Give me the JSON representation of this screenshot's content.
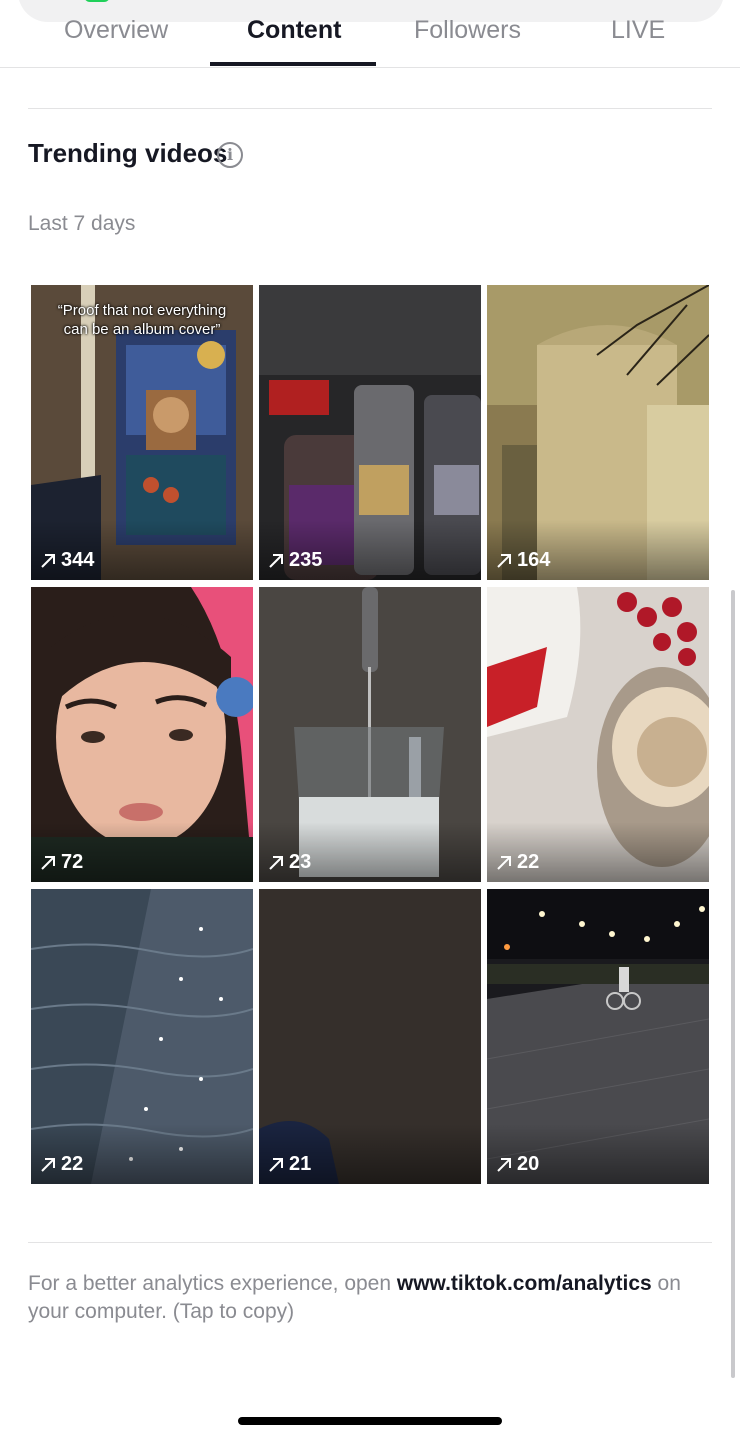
{
  "tabs": [
    {
      "label": "Overview",
      "active": false
    },
    {
      "label": "Content",
      "active": true
    },
    {
      "label": "Followers",
      "active": false
    },
    {
      "label": "LIVE",
      "active": false
    }
  ],
  "trending": {
    "title": "Trending videos",
    "info_icon": "info-icon",
    "period": "Last 7 days",
    "videos": [
      {
        "views": "344",
        "caption": "“Proof that not everything can be an album cover”",
        "icon": "trending-arrow-icon"
      },
      {
        "views": "235",
        "icon": "trending-arrow-icon"
      },
      {
        "views": "164",
        "icon": "trending-arrow-icon"
      },
      {
        "views": "72",
        "icon": "trending-arrow-icon"
      },
      {
        "views": "23",
        "icon": "trending-arrow-icon"
      },
      {
        "views": "22",
        "icon": "trending-arrow-icon"
      },
      {
        "views": "22",
        "icon": "trending-arrow-icon"
      },
      {
        "views": "21",
        "icon": "trending-arrow-icon"
      },
      {
        "views": "20",
        "icon": "trending-arrow-icon"
      }
    ]
  },
  "footer": {
    "prefix": "For a better analytics experience, open ",
    "link": "www.tiktok.com/analytics",
    "suffix": " on your computer. (Tap to copy)"
  },
  "colors": {
    "text_primary": "#161823",
    "text_secondary": "#8a8b91",
    "divider": "#e3e3e4",
    "status_green": "#20d05a"
  }
}
